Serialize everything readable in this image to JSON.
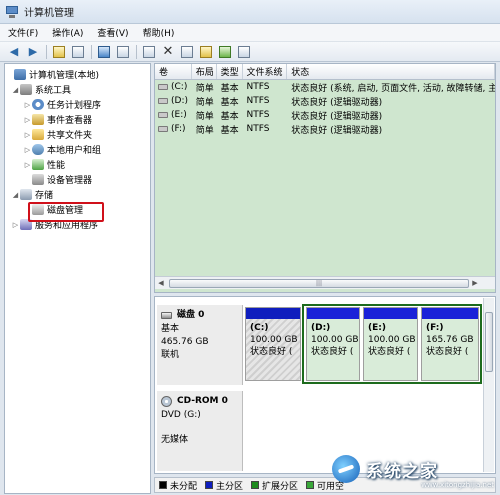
{
  "window": {
    "title": "计算机管理"
  },
  "menu": [
    "文件(F)",
    "操作(A)",
    "查看(V)",
    "帮助(H)"
  ],
  "toolbar": {
    "buttons": [
      "back-icon",
      "forward-icon",
      "up-folder-icon",
      "show-hide-tree-icon",
      "help-icon",
      "export-icon",
      "delete-icon",
      "properties-icon",
      "open-icon",
      "search-icon",
      "settings-icon"
    ]
  },
  "tree": {
    "root": "计算机管理(本地)",
    "system_tools": "系统工具",
    "task_scheduler": "任务计划程序",
    "event_viewer": "事件查看器",
    "shared_folders": "共享文件夹",
    "local_users": "本地用户和组",
    "performance": "性能",
    "device_manager": "设备管理器",
    "storage": "存储",
    "disk_management": "磁盘管理",
    "services": "服务和应用程序"
  },
  "volume_table": {
    "columns": [
      "卷",
      "布局",
      "类型",
      "文件系统",
      "状态"
    ],
    "rows": [
      {
        "volume": "(C:)",
        "layout": "简单",
        "type": "基本",
        "fs": "NTFS",
        "status": "状态良好 (系统, 启动, 页面文件, 活动, 故障转储, 主分区)"
      },
      {
        "volume": "(D:)",
        "layout": "简单",
        "type": "基本",
        "fs": "NTFS",
        "status": "状态良好 (逻辑驱动器)"
      },
      {
        "volume": "(E:)",
        "layout": "简单",
        "type": "基本",
        "fs": "NTFS",
        "status": "状态良好 (逻辑驱动器)"
      },
      {
        "volume": "(F:)",
        "layout": "简单",
        "type": "基本",
        "fs": "NTFS",
        "status": "状态良好 (逻辑驱动器)"
      }
    ]
  },
  "disk0": {
    "name": "磁盘 0",
    "type": "基本",
    "size": "465.76 GB",
    "state": "联机",
    "partitions": [
      {
        "label": "(C:)",
        "size": "100.00 GB",
        "status": "状态良好 ("
      },
      {
        "label": "(D:)",
        "size": "100.00 GB",
        "status": "状态良好 ("
      },
      {
        "label": "(E:)",
        "size": "100.00 GB",
        "status": "状态良好 ("
      },
      {
        "label": "(F:)",
        "size": "165.76 GB",
        "status": "状态良好 ("
      }
    ]
  },
  "cdrom": {
    "name": "CD-ROM 0",
    "drive": "DVD (G:)",
    "media": "无媒体"
  },
  "legend": [
    {
      "label": "未分配",
      "color": "#000000"
    },
    {
      "label": "主分区",
      "color": "#0f1ebe"
    },
    {
      "label": "扩展分区",
      "color": "#1d8a1d"
    },
    {
      "label": "可用空",
      "color": "#3aa83a"
    }
  ],
  "watermark": {
    "text": "系统之家",
    "url": "www.xitongzhijia.net"
  },
  "colors": {
    "volume_bg": "#cfe6cf",
    "primary_bar": "#0f1ebe",
    "extended_border": "#1d6b1d",
    "highlight": "#d0101a"
  }
}
